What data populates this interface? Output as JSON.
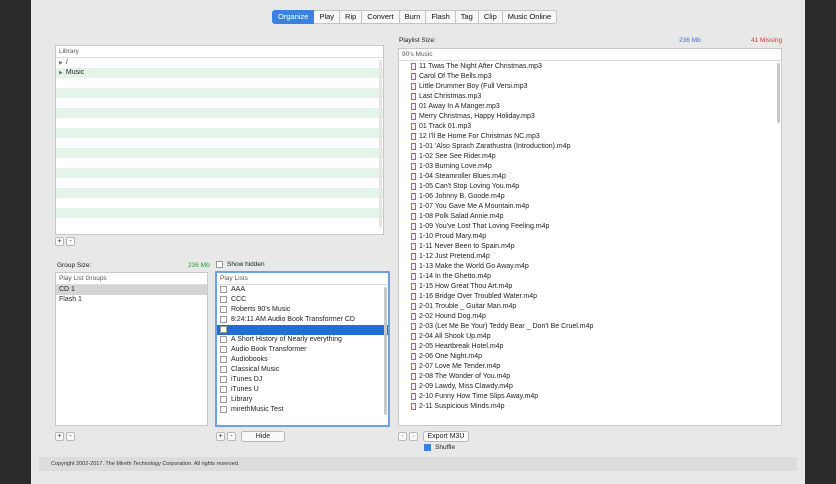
{
  "toolbar": {
    "tabs": [
      "Organize",
      "Play",
      "Rip",
      "Convert",
      "Burn",
      "Flash",
      "Tag",
      "Clip",
      "Music Online"
    ],
    "active": "Organize"
  },
  "library": {
    "header": "Library",
    "items": [
      {
        "label": "/",
        "arrow": "▶"
      },
      {
        "label": "Music",
        "arrow": "▶"
      }
    ],
    "add_label": "+",
    "remove_label": "-"
  },
  "group": {
    "size_label": "Group Size:",
    "size_value": "236 Mb",
    "show_hidden_label": "Show hidden",
    "groups_header": "Play List Groups",
    "groups": [
      "CD 1",
      "Flash 1"
    ],
    "selected_group": 0,
    "add_label": "+",
    "remove_label": "-"
  },
  "playlists": {
    "header": "Play Lists",
    "items": [
      "AAA",
      "CCC",
      "Roberts 90's Music",
      "8:24:11 AM Audio Book Transformer CD",
      "",
      "A Short History of Nearly everything",
      "Audio Book Transformer",
      "Audiobooks",
      "Classical Music",
      "iTunes DJ",
      "iTunes U",
      "Library",
      "mirethMusic Test"
    ],
    "selected_index": 4,
    "add_label": "+",
    "remove_label": "-",
    "hide_label": "Hide"
  },
  "playlist": {
    "size_label": "Playlist Size:",
    "size_value": "236 Mb",
    "missing_label": "41 Missing",
    "name": "90's Music",
    "tracks": [
      "11 Twas The Night After Christmas.mp3",
      "Carol Of The Bells.mp3",
      "Little Drummer Boy (Full Versi.mp3",
      "Last Christmas.mp3",
      "01 Away In A Manger.mp3",
      "Merry Christmas, Happy Holiday.mp3",
      "01 Track 01.mp3",
      "12 I'll Be Home For Christmas  NC.mp3",
      "1-01 'Also Sprach Zarathustra (Introduction).m4p",
      "1-02 See See Rider.m4p",
      "1-03 Burning Love.m4p",
      "1-04 Steamroller Blues.m4p",
      "1-05 Can't Stop Loving You.m4p",
      "1-06 Johnny B. Goode.m4p",
      "1-07 You Gave Me A Mountain.m4p",
      "1-08 Polk Salad Annie.m4p",
      "1-09 You've Lost That Loving Feeling.m4p",
      "1-10 Proud Mary.m4p",
      "1-11 Never Been to Spain.m4p",
      "1-12 Just Pretend.m4p",
      "1-13 Make the World Go Away.m4p",
      "1-14 In the Ghetto.m4p",
      "1-15 How Great Thou Art.m4p",
      "1-16 Bridge Over Troubled Water.m4p",
      "2-01 Trouble _ Guitar Man.m4p",
      "2-02 Hound Dog.m4p",
      "2-03 (Let Me Be Your) Teddy Bear _ Don't Be Cruel.m4p",
      "2-04 All Shook Up.m4p",
      "2-05 Heartbreak Hotel.m4p",
      "2-06 One Night.m4p",
      "2-07 Love Me Tender.m4p",
      "2-08 The Wonder of You.m4p",
      "2-09 Lawdy, Miss Clawdy.m4p",
      "2-10 Funny How Time Slips Away.m4p",
      "2-11 Suspicious Minds.m4p"
    ],
    "export_label": "Export M3U",
    "shuffle_label": "Shuffle",
    "shuffle_on": true,
    "prev_label": "‹",
    "next_label": "›"
  },
  "footer": {
    "copyright": "Copyright 2002-2017.  The Mireth Technology Corporation. All rights reserved."
  },
  "colors": {
    "accent": "#3b82e0",
    "size_green": "#2aa02a",
    "size_blue": "#3b6fd6",
    "missing_red": "#e03030",
    "stripe": "#e5f4e8"
  },
  "icons": {
    "track": "audio-file-icon",
    "folder_toggle": "disclosure-triangle-icon"
  }
}
